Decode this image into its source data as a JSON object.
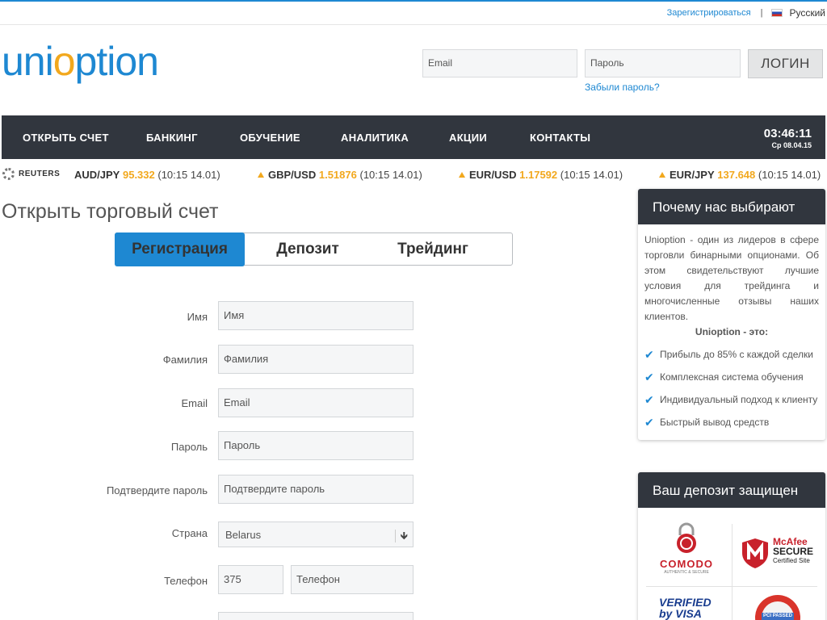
{
  "header": {
    "register_link": "Зарегистрироваться",
    "separator": "|",
    "language": "Русский",
    "logo_part1": "uni",
    "logo_part2": "o",
    "logo_part3": "ption",
    "email_placeholder": "Email",
    "password_placeholder": "Пароль",
    "login_button": "ЛОГИН",
    "forgot_password": "Забыли пароль?"
  },
  "nav": {
    "items": [
      "ОТКРЫТЬ СЧЕТ",
      "БАНКИНГ",
      "ОБУЧЕНИЕ",
      "АНАЛИТИКА",
      "АКЦИИ",
      "КОНТАКТЫ"
    ],
    "time": "03:46:11",
    "date": "Ср 08.04.15"
  },
  "ticker": {
    "source": "REUTERS",
    "quotes": [
      {
        "pair": "AUD/JPY",
        "value": "95.332",
        "time": "(10:15 14.01)",
        "arrow": false
      },
      {
        "pair": "GBP/USD",
        "value": "1.51876",
        "time": "(10:15 14.01)",
        "arrow": true
      },
      {
        "pair": "EUR/USD",
        "value": "1.17592",
        "time": "(10:15 14.01)",
        "arrow": true
      },
      {
        "pair": "EUR/JPY",
        "value": "137.648",
        "time": "(10:15 14.01)",
        "arrow": true
      }
    ]
  },
  "main": {
    "title": "Открыть торговый счет",
    "steps": [
      "Регистрация",
      "Депозит",
      "Трейдинг"
    ],
    "form": {
      "first_name_label": "Имя",
      "first_name_placeholder": "Имя",
      "last_name_label": "Фамилия",
      "last_name_placeholder": "Фамилия",
      "email_label": "Email",
      "email_placeholder": "Email",
      "password_label": "Пароль",
      "password_placeholder": "Пароль",
      "confirm_label": "Подтвердите пароль",
      "confirm_placeholder": "Подтвердите пароль",
      "country_label": "Страна",
      "country_value": "Belarus",
      "phone_label": "Телефон",
      "phone_code": "375",
      "phone_placeholder": "Телефон"
    }
  },
  "sidebar": {
    "why_title": "Почему нас выбирают",
    "why_text": "Unioption - один из лидеров в сфере торговли бинарными опционами. Об этом свидетельствуют лучшие условия для трейдинга и многочисленные отзывы наших клиентов.",
    "why_sub": "Unioption - это:",
    "benefits": [
      "Прибыль до 85% с каждой сделки",
      "Комплексная система обучения",
      "Индивидуальный подход к клиенту",
      "Быстрый вывод средств"
    ],
    "deposit_title": "Ваш депозит защищен",
    "badges": {
      "comodo": "COMODO",
      "comodo_sub": "AUTHENTIC & SECURE",
      "mcafee": "McAfee",
      "mcafee_secure": "SECURE",
      "mcafee_sub": "Certified Site",
      "visa_verified": "VERIFIED",
      "visa_by": "by VISA",
      "pci": "PCI PASSED"
    }
  },
  "colors": {
    "accent": "#1e88d2",
    "orange": "#f2a81d",
    "dark": "#31363e"
  }
}
